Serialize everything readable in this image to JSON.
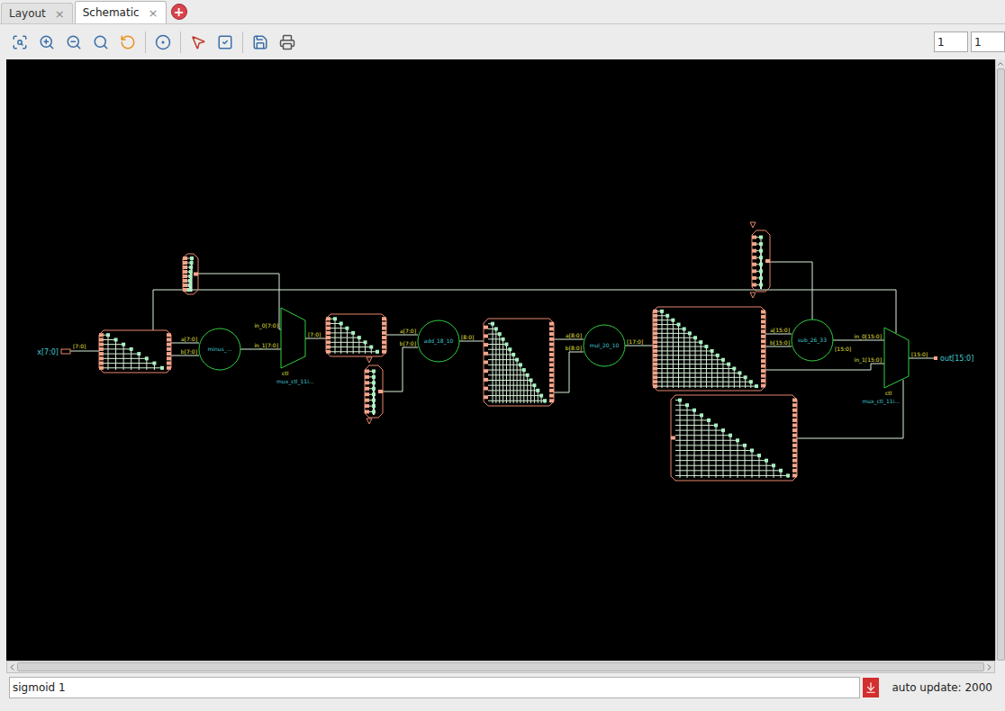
{
  "tabs": [
    {
      "label": "Layout",
      "selected": false,
      "close": "×"
    },
    {
      "label": "Schematic",
      "selected": true,
      "close": "×"
    }
  ],
  "add_tab": "+",
  "page_fields": [
    "1",
    "1"
  ],
  "schematic": {
    "input_port": {
      "label": "x[7:0]",
      "bus": "[7:0]"
    },
    "output_port": {
      "label": "out[15:0]"
    },
    "operators": [
      {
        "label": "minus_...",
        "inputs": [
          "a[7:0]",
          "b[7:0]"
        ],
        "output": ""
      },
      {
        "label": "add_18_10",
        "inputs": [
          "a[7:0]",
          "b[7:0]"
        ],
        "output": "[8:0]"
      },
      {
        "label": "mul_20_10",
        "inputs": [
          "a[8:0]",
          "b[8:0]"
        ],
        "output": "[17:0]"
      },
      {
        "label": "sub_26_33",
        "inputs": [
          "a[15:0]",
          "b[15:0]"
        ],
        "output": "[15:0]"
      }
    ],
    "muxes": [
      {
        "label": "mux_ctl_11i...",
        "inputs": [
          "in_0[7:0]",
          "in_1[7:0]"
        ],
        "ctl": "ctl",
        "output": "[7:0]"
      },
      {
        "label": "mux_ctl_11i...",
        "inputs": [
          "in_0[15:0]",
          "in_1[15:0]"
        ],
        "ctl": "ctl",
        "output": "[15:0]"
      }
    ]
  },
  "status_bar": {
    "path": "sigmoid 1",
    "auto_update": "auto update: 2000"
  }
}
